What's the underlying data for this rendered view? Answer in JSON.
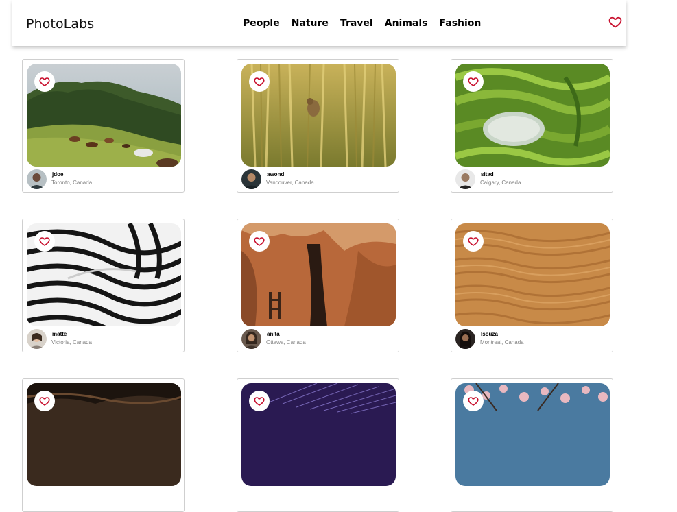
{
  "app": {
    "logo": "PhotoLabs"
  },
  "nav": {
    "topics": [
      "People",
      "Nature",
      "Travel",
      "Animals",
      "Fashion"
    ]
  },
  "photos": [
    {
      "username": "jdoe",
      "location": "Toronto, Canada",
      "scene": "horses-hillside"
    },
    {
      "username": "awond",
      "location": "Vancouver, Canada",
      "scene": "bird-reeds"
    },
    {
      "username": "sitad",
      "location": "Calgary, Canada",
      "scene": "rice-terraces"
    },
    {
      "username": "matte",
      "location": "Victoria, Canada",
      "scene": "zebra-stripes"
    },
    {
      "username": "anita",
      "location": "Ottawa, Canada",
      "scene": "canyon-rock"
    },
    {
      "username": "lsouza",
      "location": "Montreal, Canada",
      "scene": "sand-dunes"
    },
    {
      "username": "",
      "location": "",
      "scene": "dark-rock"
    },
    {
      "username": "",
      "location": "",
      "scene": "star-trails"
    },
    {
      "username": "",
      "location": "",
      "scene": "blossom-tree"
    }
  ],
  "colors": {
    "heart": "#c8102e",
    "nav_shadow": "rgba(0,0,0,0.22)"
  }
}
